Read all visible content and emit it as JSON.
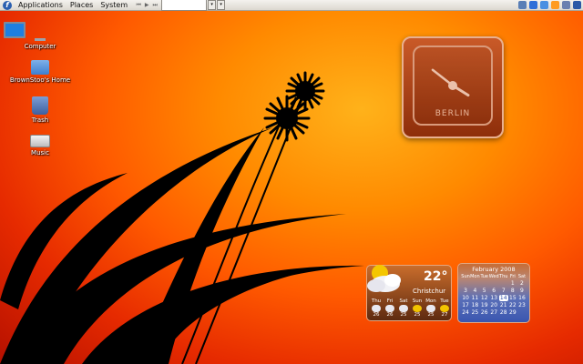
{
  "panel": {
    "menus": [
      "Applications",
      "Places",
      "System"
    ],
    "search_value": ""
  },
  "desktop_icons": [
    {
      "label": "Computer",
      "icon": "computer-icon"
    },
    {
      "label": "BrownStoo's Home",
      "icon": "home-folder-icon"
    },
    {
      "label": "Trash",
      "icon": "trash-icon"
    },
    {
      "label": "Music",
      "icon": "drive-icon"
    }
  ],
  "clock": {
    "city": "BERLIN",
    "hour_hand_deg": 122,
    "minute_hand_deg": 308,
    "colors": {
      "body": "#b8461a",
      "accent": "#e9b090"
    }
  },
  "weather": {
    "temperature": "22°",
    "city": "Christchur",
    "days": [
      {
        "name": "Thu",
        "temp": "26",
        "icon": "cloud"
      },
      {
        "name": "Fri",
        "temp": "26",
        "icon": "cloud"
      },
      {
        "name": "Sat",
        "temp": "25",
        "icon": "cloud"
      },
      {
        "name": "Sun",
        "temp": "25",
        "icon": "sun"
      },
      {
        "name": "Mon",
        "temp": "25",
        "icon": "cloud"
      },
      {
        "name": "Tue",
        "temp": "27",
        "icon": "sun"
      }
    ]
  },
  "calendar": {
    "title": "February 2008",
    "weekdays": [
      "Sun",
      "Mon",
      "Tue",
      "Wed",
      "Thu",
      "Fri",
      "Sat"
    ],
    "days": [
      "",
      "",
      "",
      "",
      "",
      "1",
      "2",
      "3",
      "4",
      "5",
      "6",
      "7",
      "8",
      "9",
      "10",
      "11",
      "12",
      "13",
      "14",
      "15",
      "16",
      "17",
      "18",
      "19",
      "20",
      "21",
      "22",
      "23",
      "24",
      "25",
      "26",
      "27",
      "28",
      "29",
      ""
    ],
    "today": "14"
  },
  "wallpaper": {
    "colors": {
      "center": "#ffb21a",
      "edge": "#b51000",
      "silhouette": "#000000"
    }
  }
}
